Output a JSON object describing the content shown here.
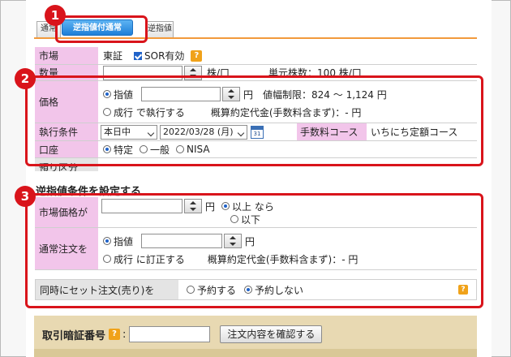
{
  "tabs": {
    "normal": "通常",
    "active": "逆指値付通常",
    "trigger": "逆指値"
  },
  "badges": [
    "1",
    "2",
    "3"
  ],
  "market": {
    "label": "市場",
    "value": "東証",
    "sor_label": "SOR有効"
  },
  "quantity": {
    "label": "数量",
    "unit": "株/口",
    "unit_info": "単元株数：100 株/口"
  },
  "price": {
    "label": "価格",
    "limit_label": "指値",
    "yen": "円",
    "price_range": "値幅制限：824 〜 1,124 円",
    "market_label": "成行 で執行する",
    "estimate": "概算約定代金(手数料含まず)：- 円"
  },
  "condition": {
    "label": "執行条件",
    "period": "本日中",
    "date": "2022/03/28 (月)",
    "calendar_text": "31",
    "fee_label": "手数料コース",
    "fee_value": "いちにち定額コース"
  },
  "account": {
    "label": "口座",
    "opt1": "特定",
    "opt2": "一般",
    "opt3": "NISA"
  },
  "hidden_row": {
    "label": "預り区分"
  },
  "stop_section": {
    "title": "逆指値条件を設定する",
    "market_price_label": "市場価格が",
    "yen": "円",
    "above": "以上 なら",
    "below": "以下",
    "normal_order_label": "通常注文を",
    "limit_label": "指値",
    "market_label": "成行 に訂正する",
    "estimate": "概算約定代金(手数料含まず)：- 円",
    "set_order_label": "同時にセット注文(売り)を",
    "opt_yes": "予約する",
    "opt_no": "予約しない"
  },
  "bottom": {
    "pin_label": "取引暗証番号",
    "confirm_button": "注文内容を確認する"
  },
  "colors": {
    "accent_red": "#d9141b",
    "label_pink": "#f2c5ea",
    "tab_blue": "#1e7fd8",
    "help_orange": "#f0a21a"
  }
}
